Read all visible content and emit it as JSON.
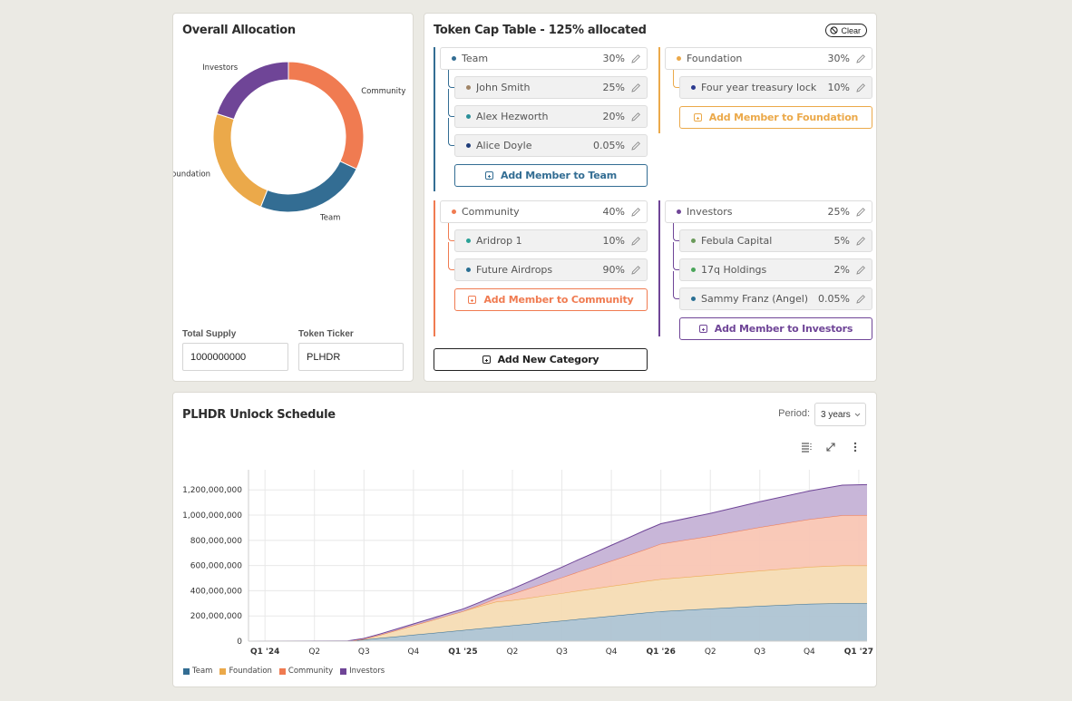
{
  "colors": {
    "team": "#336d93",
    "foundation": "#eba94a",
    "community": "#f07b51",
    "investors": "#6f4597",
    "teamFill": "#aec4d3",
    "foundationFill": "#f5dcb4",
    "communityFill": "#f9c6b4",
    "investorsFill": "#c5b2d6"
  },
  "allocation": {
    "title": "Overall Allocation",
    "total_supply_label": "Total Supply",
    "total_supply_value": "1000000000",
    "token_ticker_label": "Token Ticker",
    "token_ticker_value": "PLHDR"
  },
  "cap_table": {
    "title": "Token Cap Table - 125% allocated",
    "clear_label": "Clear",
    "add_category_label": "Add New Category",
    "groups": [
      {
        "name": "Team",
        "percent": "30%",
        "color_key": "team",
        "add_label": "Add Member to Team",
        "members": [
          {
            "name": "John Smith",
            "percent": "25%",
            "dot": "#a08466"
          },
          {
            "name": "Alex Hezworth",
            "percent": "20%",
            "dot": "#2a8f99"
          },
          {
            "name": "Alice Doyle",
            "percent": "0.05%",
            "dot": "#1f3c7a"
          }
        ]
      },
      {
        "name": "Foundation",
        "percent": "30%",
        "color_key": "foundation",
        "add_label": "Add Member to Foundation",
        "members": [
          {
            "name": "Four year treasury lock",
            "percent": "10%",
            "dot": "#2b3a8f"
          }
        ]
      },
      {
        "name": "Community",
        "percent": "40%",
        "color_key": "community",
        "add_label": "Add Member to Community",
        "members": [
          {
            "name": "Aridrop 1",
            "percent": "10%",
            "dot": "#2aa196"
          },
          {
            "name": "Future Airdrops",
            "percent": "90%",
            "dot": "#2a6f93"
          }
        ]
      },
      {
        "name": "Investors",
        "percent": "25%",
        "color_key": "investors",
        "add_label": "Add Member to Investors",
        "members": [
          {
            "name": "Febula Capital",
            "percent": "5%",
            "dot": "#6a9a5a"
          },
          {
            "name": "17q Holdings",
            "percent": "2%",
            "dot": "#4aa55a"
          },
          {
            "name": "Sammy Franz (Angel)",
            "percent": "0.05%",
            "dot": "#2a6f93"
          }
        ]
      }
    ]
  },
  "schedule": {
    "title": "PLHDR Unlock Schedule",
    "period_label": "Period:",
    "period_value": "3 years",
    "icons": [
      "table-view-icon",
      "expand-icon",
      "more-options-icon"
    ]
  },
  "chart_data": [
    {
      "type": "pie",
      "title": "Overall Allocation",
      "donut": true,
      "categories": [
        "Community",
        "Team",
        "Foundation",
        "Investors"
      ],
      "values": [
        40,
        30,
        30,
        25
      ]
    },
    {
      "type": "area",
      "stacked": true,
      "title": "PLHDR Unlock Schedule",
      "x_ticks": [
        {
          "label": "Q1 '24",
          "bold": true,
          "month": 1
        },
        {
          "label": "Q2",
          "bold": false,
          "month": 4
        },
        {
          "label": "Q3",
          "bold": false,
          "month": 7
        },
        {
          "label": "Q4",
          "bold": false,
          "month": 10
        },
        {
          "label": "Q1 '25",
          "bold": true,
          "month": 13
        },
        {
          "label": "Q2",
          "bold": false,
          "month": 16
        },
        {
          "label": "Q3",
          "bold": false,
          "month": 19
        },
        {
          "label": "Q4",
          "bold": false,
          "month": 22
        },
        {
          "label": "Q1 '26",
          "bold": true,
          "month": 25
        },
        {
          "label": "Q2",
          "bold": false,
          "month": 28
        },
        {
          "label": "Q3",
          "bold": false,
          "month": 31
        },
        {
          "label": "Q4",
          "bold": false,
          "month": 34
        },
        {
          "label": "Q1 '27",
          "bold": true,
          "month": 37
        }
      ],
      "x_range_months": [
        0,
        37.5
      ],
      "y_ticks": [
        0,
        200000000,
        400000000,
        600000000,
        800000000,
        1000000000,
        1200000000
      ],
      "y_tick_labels": [
        "0",
        "200,000,000",
        "400,000,000",
        "600,000,000",
        "800,000,000",
        "1,000,000,000",
        "1,200,000,000"
      ],
      "ylim": [
        0,
        1360000000
      ],
      "legend": "bottom-left",
      "x_months": [
        0,
        6,
        7,
        8,
        9,
        10,
        11,
        12,
        13,
        14,
        15,
        16,
        17,
        18,
        19,
        20,
        21,
        22,
        23,
        24,
        25,
        28,
        31,
        34,
        36,
        37.5
      ],
      "series": [
        {
          "name": "Team",
          "color_key": "team",
          "values": [
            0,
            0,
            12,
            25,
            37,
            50,
            62,
            75,
            87,
            100,
            112,
            125,
            137,
            150,
            162,
            175,
            187,
            200,
            212,
            225,
            237,
            258,
            279,
            296,
            300,
            300
          ]
        },
        {
          "name": "Foundation",
          "color_key": "foundation",
          "values": [
            0,
            0,
            5,
            25,
            50,
            75,
            100,
            125,
            150,
            175,
            200,
            200,
            206,
            212,
            218,
            225,
            231,
            237,
            243,
            250,
            255,
            266,
            280,
            293,
            300,
            300
          ]
        },
        {
          "name": "Community",
          "color_key": "community",
          "values": [
            0,
            0,
            0,
            0,
            0,
            0,
            0,
            0,
            0,
            10,
            25,
            50,
            75,
            100,
            125,
            150,
            175,
            200,
            225,
            250,
            280,
            310,
            345,
            378,
            398,
            400
          ]
        },
        {
          "name": "Investors",
          "color_key": "investors",
          "values": [
            0,
            2,
            5,
            8,
            10,
            12,
            14,
            16,
            18,
            22,
            26,
            40,
            54,
            68,
            82,
            96,
            110,
            124,
            138,
            152,
            160,
            180,
            202,
            225,
            240,
            242
          ]
        }
      ],
      "value_unit": "millions of tokens"
    }
  ]
}
